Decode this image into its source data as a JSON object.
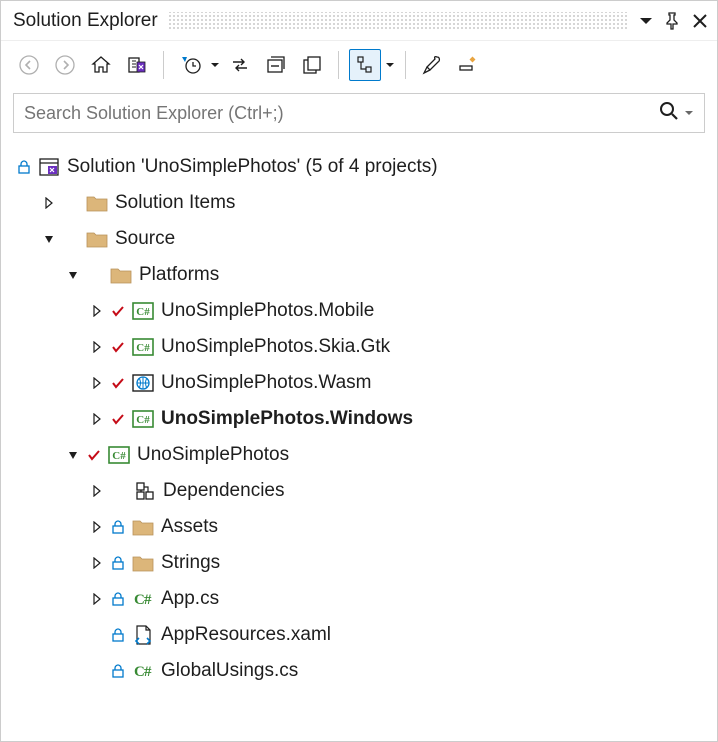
{
  "title": "Solution Explorer",
  "search_placeholder": "Search Solution Explorer (Ctrl+;)",
  "solution": {
    "label": "Solution 'UnoSimplePhotos' (5 of 4 projects)"
  },
  "tree": {
    "solution_items": "Solution Items",
    "source": "Source",
    "platforms": "Platforms",
    "mobile": "UnoSimplePhotos.Mobile",
    "skia": "UnoSimplePhotos.Skia.Gtk",
    "wasm": "UnoSimplePhotos.Wasm",
    "windows": "UnoSimplePhotos.Windows",
    "main_project": "UnoSimplePhotos",
    "dependencies": "Dependencies",
    "assets": "Assets",
    "strings": "Strings",
    "app_cs": "App.cs",
    "app_resources": "AppResources.xaml",
    "global_usings": "GlobalUsings.cs"
  }
}
